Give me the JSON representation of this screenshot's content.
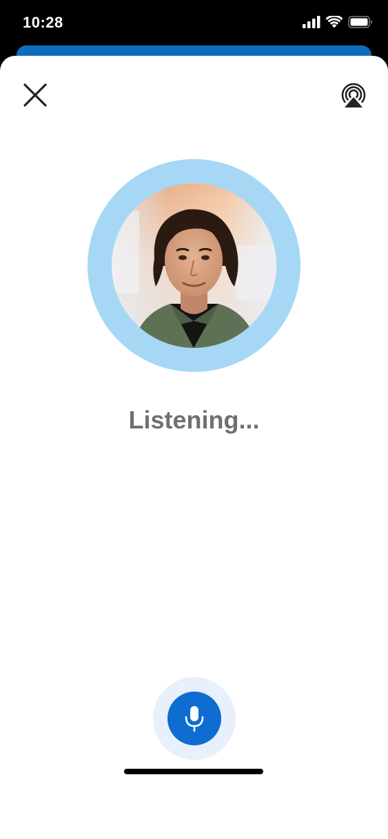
{
  "status_bar": {
    "time": "10:28",
    "icons": [
      "cellular-signal-icon",
      "wifi-icon",
      "battery-icon"
    ]
  },
  "header": {
    "close_icon": "close-icon",
    "airplay_icon": "airplay-icon"
  },
  "avatar": {
    "ring_color": "#a6d8f5",
    "image": "person-photo"
  },
  "main": {
    "status_label": "Listening..."
  },
  "mic": {
    "icon": "microphone-icon",
    "button_color": "#0f6cd0",
    "halo_color": "#e7f0fb"
  },
  "colors": {
    "accent": "#0f6cbd",
    "text_secondary": "#707070"
  }
}
